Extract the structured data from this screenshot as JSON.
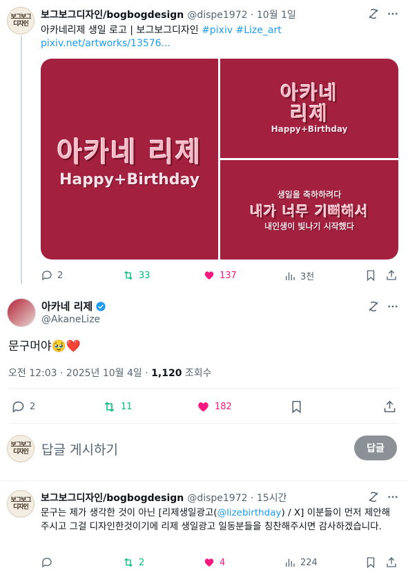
{
  "tweet1": {
    "display_name": "보그보그디자인/bogbogdesign",
    "handle_date": "@dispe1972 · 10월 1일",
    "text": "아카네리제 생일 로고 | 보그보그디자인",
    "hashtags": "#pixiv #Lize_art",
    "url": "pixiv.net/artworks/13576...",
    "media": {
      "main_logo": "아카네 리제",
      "main_sub": "Happy+Birthday",
      "tr_logo_line1": "아카네",
      "tr_logo_line2": "리제",
      "tr_sub": "Happy+Birthday",
      "br_line1": "생일을 축하하려다",
      "br_line2": "내가 너무 기뻐해서",
      "br_line3": "내인생이 빛나기 시작했다"
    },
    "stats": {
      "replies": "2",
      "retweets": "33",
      "likes": "137",
      "views": "3천"
    }
  },
  "tweet2": {
    "display_name": "아카네 리제",
    "handle": "@AkaneLize",
    "text": "문구머야🥹❤️",
    "meta_time": "오전 12:03 · 2025년 10월 4일 · ",
    "views_count": "1,120",
    "views_label": " 조회수",
    "stats": {
      "replies": "2",
      "retweets": "11",
      "likes": "182"
    }
  },
  "compose": {
    "placeholder": "답글 게시하기",
    "button": "답글",
    "avatar_text": [
      "보그보그",
      "디자인"
    ]
  },
  "tweet3": {
    "display_name": "보그보그디자인/bogbogdesign",
    "handle_date": "@dispe1972 · 15시간",
    "text_before": "문구는 제가 생각한 것이 아닌 [리제생일광고(",
    "mention": "@lizebirthday",
    "text_after": ") / X] 이분들이 먼저 제안해주시고 그걸 디자인한것이기에 리제 생일광고 일동분들을 칭찬해주시면 감사하겠습니다.",
    "stats": {
      "replies": "",
      "retweets": "2",
      "likes": "4",
      "views": "224"
    }
  },
  "colors": {
    "link": "#1d9bf0",
    "retweet": "#00ba7c",
    "like": "#f91880",
    "media_bg": "#a3213f",
    "verified": "#1d9bf0"
  }
}
